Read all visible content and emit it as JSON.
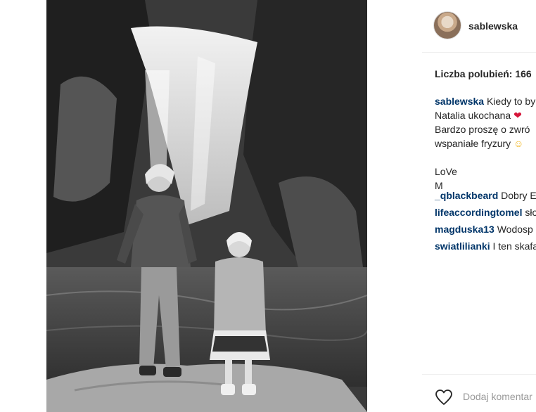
{
  "post": {
    "username": "sablewska",
    "likes_text": "Liczba polubień: 166",
    "caption": {
      "author": "sablewska",
      "line1": "Kiedy to by",
      "line2": "Natalia ukochana",
      "line2_emoji": "❤",
      "line3": "Bardzo proszę o zwró",
      "line4": "wspaniałe fryzury",
      "line4_emoji": "☺",
      "line5": "LoVe",
      "line6": "M"
    },
    "comments": [
      {
        "user": "_qblackbeard",
        "text": "Dobry E"
      },
      {
        "user": "lifeaccordingtomel",
        "text": "sło"
      },
      {
        "user": "magduska13",
        "text": "Wodosp"
      },
      {
        "user": "swiatlilianki",
        "text": "I ten skafa"
      }
    ],
    "add_comment_placeholder": "Dodaj komentar"
  },
  "icons": {
    "like": "heart-outline-icon"
  },
  "colors": {
    "username": "#003569",
    "text": "#262626",
    "placeholder": "#999999",
    "heart": "#d6163a"
  }
}
